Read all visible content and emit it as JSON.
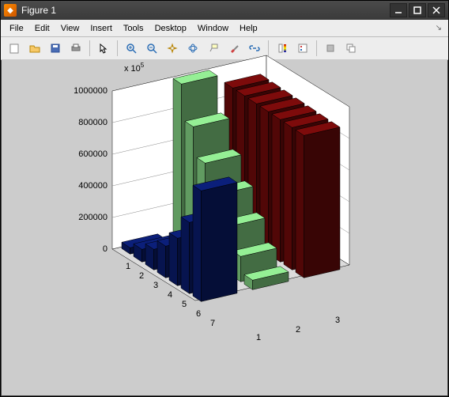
{
  "window": {
    "title": "Figure 1"
  },
  "menu": {
    "items": [
      "File",
      "Edit",
      "View",
      "Insert",
      "Tools",
      "Desktop",
      "Window",
      "Help"
    ]
  },
  "toolbar": {
    "buttons": [
      {
        "name": "new-figure-icon"
      },
      {
        "name": "open-icon"
      },
      {
        "name": "save-icon"
      },
      {
        "name": "print-icon"
      },
      {
        "sep": true
      },
      {
        "name": "pointer-icon"
      },
      {
        "sep": true
      },
      {
        "name": "zoom-in-icon"
      },
      {
        "name": "zoom-out-icon"
      },
      {
        "name": "pan-icon"
      },
      {
        "name": "rotate3d-icon"
      },
      {
        "name": "datacursor-icon"
      },
      {
        "name": "brush-icon"
      },
      {
        "name": "link-icon"
      },
      {
        "sep": true
      },
      {
        "name": "colorbar-icon"
      },
      {
        "name": "legend-icon"
      },
      {
        "sep": true
      },
      {
        "name": "hide-tools-icon"
      },
      {
        "name": "show-tools-icon"
      }
    ]
  },
  "chart_data": {
    "type": "bar",
    "title": "",
    "multiplier_label": "x 10",
    "multiplier_exponent": "5",
    "x_categories": [
      "1",
      "2",
      "3",
      "4",
      "5",
      "6",
      "7"
    ],
    "y_categories": [
      "1",
      "2",
      "3"
    ],
    "z_ticks": [
      "0",
      "200000",
      "400000",
      "600000",
      "800000",
      "1000000"
    ],
    "zlim": [
      0,
      1000000
    ],
    "series": [
      {
        "name": "1",
        "color": "#0b1f7a",
        "values": [
          40000,
          80000,
          130000,
          200000,
          300000,
          450000,
          700000
        ]
      },
      {
        "name": "2",
        "color": "#95ef95",
        "values": [
          1000000,
          780000,
          600000,
          450000,
          300000,
          160000,
          60000
        ]
      },
      {
        "name": "3",
        "color": "#7d0b0b",
        "values": [
          900000,
          900000,
          900000,
          900000,
          900000,
          900000,
          900000
        ]
      }
    ]
  }
}
